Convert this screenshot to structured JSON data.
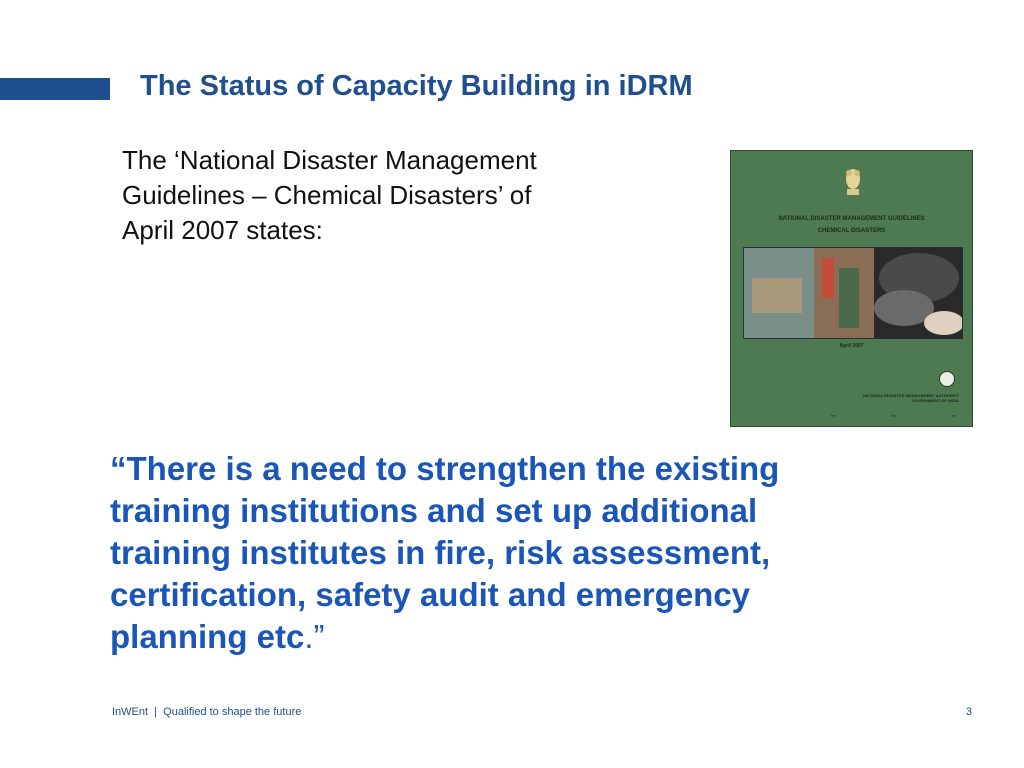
{
  "slide": {
    "title": "The Status of Capacity Building in iDRM",
    "intro_lines": [
      "The ‘National Disaster Management",
      "Guidelines – Chemical Disasters’ of",
      "April 2007 states:"
    ],
    "quote": {
      "lines": [
        "“There is a need to strengthen the existing",
        "training institutions and set up additional",
        "training institutes in fire, risk assessment,",
        "certification, safety audit and emergency"
      ],
      "last_line": "planning etc",
      "closing": ".”"
    }
  },
  "cover_image": {
    "heading": "NATIONAL DISASTER MANAGEMENT GUIDELINES",
    "subheading": "CHEMICAL DISASTERS",
    "date": "April 2007",
    "authority": "NATIONAL DISASTER MANAGEMENT AUTHORITY",
    "government": "GOVERNMENT OF INDIA",
    "colors": {
      "background": "#4d7a50"
    }
  },
  "footer": {
    "text": "InWEnt  |  Qualified to shape the future",
    "page_number": "3"
  },
  "colors": {
    "title": "#1f4f8f",
    "quote": "#1a56b8",
    "accent_bar": "#1f4f8f"
  }
}
